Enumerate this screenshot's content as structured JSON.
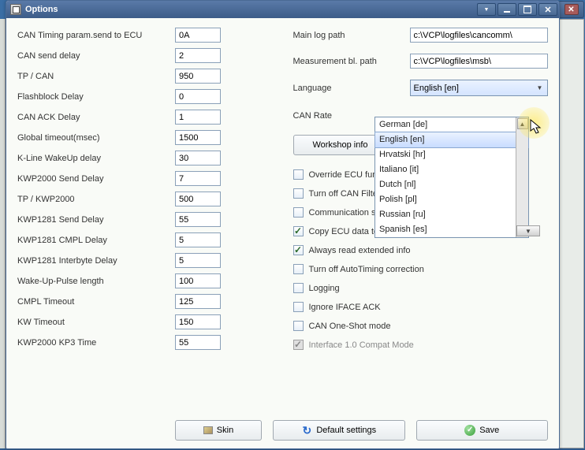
{
  "window": {
    "title": "Options"
  },
  "left_params": [
    {
      "label": "CAN Timing param.send to ECU",
      "value": "0A"
    },
    {
      "label": "CAN send delay",
      "value": "2"
    },
    {
      "label": "TP / CAN",
      "value": "950"
    },
    {
      "label": "Flashblock Delay",
      "value": "0"
    },
    {
      "label": "CAN ACK Delay",
      "value": "1"
    },
    {
      "label": "Global timeout(msec)",
      "value": "1500"
    },
    {
      "label": "K-Line WakeUp delay",
      "value": "30"
    },
    {
      "label": "KWP2000 Send Delay",
      "value": "7"
    },
    {
      "label": "TP / KWP2000",
      "value": "500"
    },
    {
      "label": "KWP1281 Send Delay",
      "value": "55"
    },
    {
      "label": "KWP1281 CMPL Delay",
      "value": "5"
    },
    {
      "label": "KWP1281 Interbyte Delay",
      "value": "5"
    },
    {
      "label": "Wake-Up-Pulse length",
      "value": "100"
    },
    {
      "label": "CMPL Timeout",
      "value": "125"
    },
    {
      "label": "KW Timeout",
      "value": "150"
    },
    {
      "label": "KWP2000 KP3 Time",
      "value": "55"
    }
  ],
  "right": {
    "main_log_label": "Main log path",
    "main_log_value": "c:\\VCP\\logfiles\\cancomm\\",
    "meas_label": "Measurement bl. path",
    "meas_value": "c:\\VCP\\logfiles\\msb\\",
    "language_label": "Language",
    "language_value": "English [en]",
    "canrate_label": "CAN Rate",
    "workshop_btn": "Workshop info"
  },
  "dropdown_items": [
    "German [de]",
    "English [en]",
    "Hrvatski [hr]",
    "Italiano [it]",
    "Dutch [nl]",
    "Polish [pl]",
    "Russian [ru]",
    "Spanish [es]"
  ],
  "checkboxes": [
    {
      "label": "Override ECU functions",
      "checked": false,
      "disabled": false
    },
    {
      "label": "Turn off CAN Filter",
      "checked": false,
      "disabled": false
    },
    {
      "label": "Communication starts automatically",
      "checked": false,
      "disabled": false
    },
    {
      "label": "Copy ECU data to clipboard",
      "checked": true,
      "disabled": false
    },
    {
      "label": "Always read extended info",
      "checked": true,
      "disabled": false
    },
    {
      "label": "Turn off AutoTiming correction",
      "checked": false,
      "disabled": false
    },
    {
      "label": "Logging",
      "checked": false,
      "disabled": false
    },
    {
      "label": "Ignore IFACE ACK",
      "checked": false,
      "disabled": false
    },
    {
      "label": "CAN One-Shot mode",
      "checked": false,
      "disabled": false
    },
    {
      "label": "Interface 1.0 Compat Mode",
      "checked": true,
      "disabled": true
    }
  ],
  "buttons": {
    "skin": "Skin",
    "defaults": "Default settings",
    "save": "Save"
  }
}
